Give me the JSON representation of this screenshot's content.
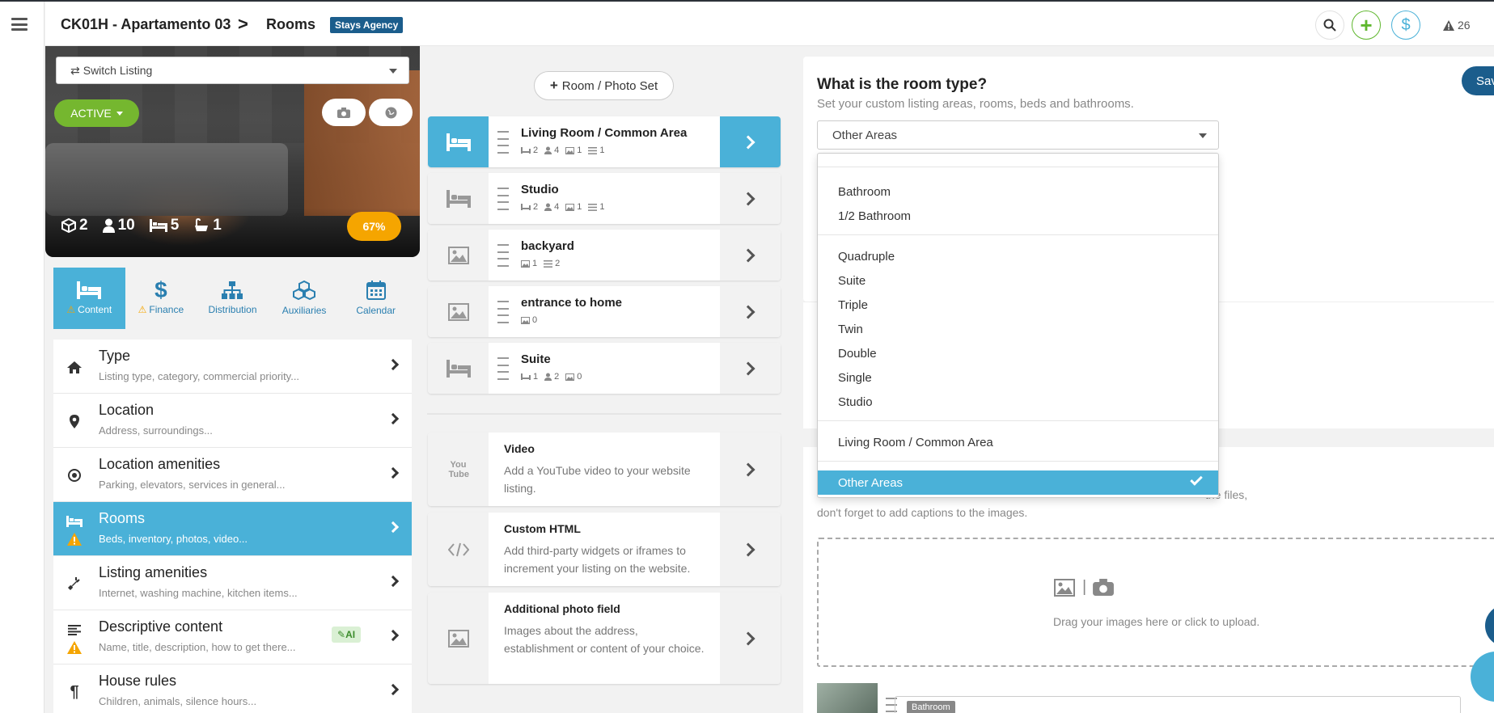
{
  "header": {
    "listing": "CK01H - Apartamento 03",
    "separator": ">",
    "page": "Rooms",
    "agency": "Stays Agency",
    "alerts": "26"
  },
  "left": {
    "switch_label": "Switch Listing",
    "status": "ACTIVE",
    "stats": {
      "rooms": "2",
      "guests": "10",
      "beds": "5",
      "baths": "1"
    },
    "progress_label": "67%",
    "progress": 67,
    "tabs": [
      {
        "label": "Content",
        "icon": "bed-icon",
        "warn": true
      },
      {
        "label": "Finance",
        "icon": "dollar-icon",
        "warn": true
      },
      {
        "label": "Distribution",
        "icon": "sitemap-icon",
        "warn": false
      },
      {
        "label": "Auxiliaries",
        "icon": "cubes-icon",
        "warn": false
      },
      {
        "label": "Calendar",
        "icon": "calendar-icon",
        "warn": false
      }
    ],
    "menu": [
      {
        "title": "Type",
        "desc": "Listing type, category, commercial priority..."
      },
      {
        "title": "Location",
        "desc": "Address, surroundings..."
      },
      {
        "title": "Location amenities",
        "desc": "Parking, elevators, services in general..."
      },
      {
        "title": "Rooms",
        "desc": "Beds, inventory, photos, video..."
      },
      {
        "title": "Listing amenities",
        "desc": "Internet, washing machine, kitchen items..."
      },
      {
        "title": "Descriptive content",
        "desc": "Name, title, description, how to get there...",
        "badge": "AI"
      },
      {
        "title": "House rules",
        "desc": "Children, animals, silence hours..."
      }
    ]
  },
  "middle": {
    "add_label": "Room / Photo Set",
    "rooms": [
      {
        "name": "Living Room / Common Area",
        "beds": "2",
        "guests": "4",
        "photos": "1",
        "items": "1"
      },
      {
        "name": "Studio",
        "beds": "2",
        "guests": "4",
        "photos": "1",
        "items": "1"
      },
      {
        "name": "backyard",
        "photos": "1",
        "items": "2"
      },
      {
        "name": "entrance to home",
        "photos": "0"
      },
      {
        "name": "Suite",
        "beds": "1",
        "guests": "2",
        "photos": "0"
      }
    ],
    "extras": [
      {
        "name": "Video",
        "desc": "Add a YouTube video to your website listing.",
        "icon_text": "You Tube"
      },
      {
        "name": "Custom HTML",
        "desc": "Add third-party widgets or iframes to increment your listing on the website."
      },
      {
        "name": "Additional photo field",
        "desc": "Images about the address, establishment or content of your choice."
      }
    ]
  },
  "right": {
    "title": "What is the room type?",
    "subtitle": "Set your custom listing areas, rooms, beds and bathrooms.",
    "save_label": "Sav",
    "selected": "Other Areas",
    "options_group1": [
      "Bathroom",
      "1/2 Bathroom"
    ],
    "options_group2": [
      "Quadruple",
      "Suite",
      "Triple",
      "Twin",
      "Double",
      "Single",
      "Studio"
    ],
    "options_group3": [
      "Living Room / Common Area"
    ],
    "options_group4": [
      "Other Areas"
    ],
    "upload_text_l1": "the files,",
    "upload_text_l2": "don't forget to add captions to the images.",
    "dropzone_text": "Drag your images here or click to upload.",
    "thumb_tag": "Bathroom"
  }
}
